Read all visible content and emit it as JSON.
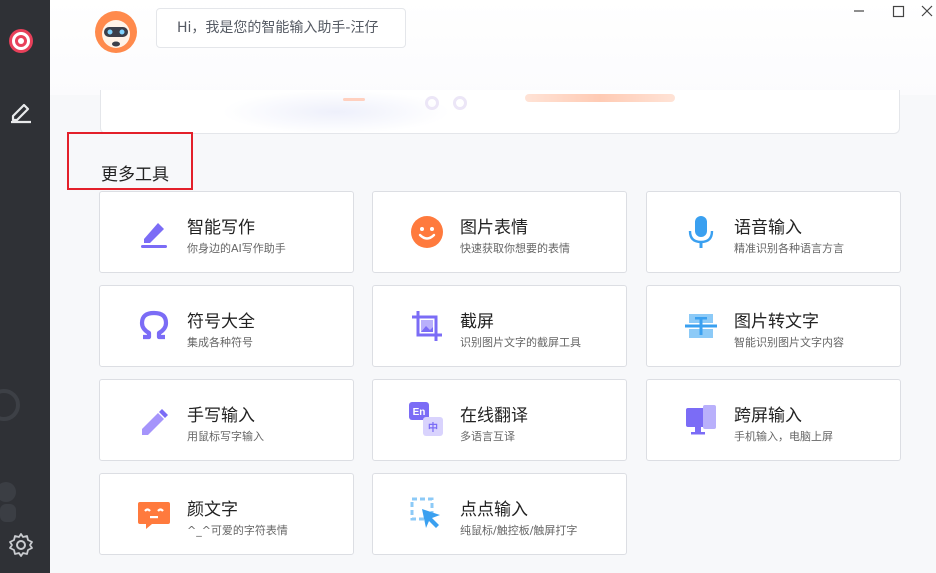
{
  "header": {
    "greeting": "Hi，我是您的智能输入助手-汪仔"
  },
  "section": {
    "title": "更多工具"
  },
  "tools": [
    {
      "title": "智能写作",
      "desc": "你身边的AI写作助手",
      "icon": "pen-write-icon"
    },
    {
      "title": "图片表情",
      "desc": "快速获取你想要的表情",
      "icon": "smiley-face-icon"
    },
    {
      "title": "语音输入",
      "desc": "精准识别各种语言方言",
      "icon": "microphone-icon"
    },
    {
      "title": "符号大全",
      "desc": "集成各种符号",
      "icon": "omega-symbol-icon"
    },
    {
      "title": "截屏",
      "desc": "识别图片文字的截屏工具",
      "icon": "screenshot-crop-icon"
    },
    {
      "title": "图片转文字",
      "desc": "智能识别图片文字内容",
      "icon": "image-to-text-icon"
    },
    {
      "title": "手写输入",
      "desc": "用鼠标写字输入",
      "icon": "pencil-icon"
    },
    {
      "title": "在线翻译",
      "desc": "多语言互译",
      "icon": "translate-icon"
    },
    {
      "title": "跨屏输入",
      "desc": "手机输入，电脑上屏",
      "icon": "cross-screen-icon"
    },
    {
      "title": "颜文字",
      "desc": "^_^可爱的字符表情",
      "icon": "emoticon-chat-icon"
    },
    {
      "title": "点点输入",
      "desc": "纯鼠标/触控板/触屏打字",
      "icon": "cursor-click-icon"
    }
  ],
  "icon_badges": {
    "translate_en": "En",
    "translate_zh": "中"
  },
  "colors": {
    "accent_purple": "#7b6cf6",
    "accent_orange": "#ff7a3d",
    "accent_blue": "#3aa0f0",
    "highlight_red": "#e3202a",
    "sidebar_bg": "#2f3136"
  }
}
